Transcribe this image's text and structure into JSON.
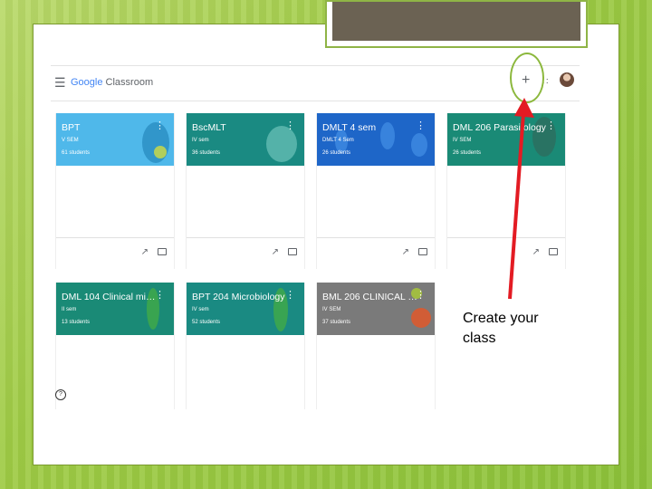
{
  "header": {
    "logo_prefix": "Google",
    "logo_suffix": " Classroom",
    "add_label": "+",
    "apps_label": "∷"
  },
  "classes": [
    {
      "title": "BPT",
      "subtitle": "V SEM",
      "students": "61 students",
      "color": "#4fb8ea"
    },
    {
      "title": "BscMLT",
      "subtitle": "IV sem",
      "students": "36 students",
      "color": "#1a8a82"
    },
    {
      "title": "DMLT 4 sem",
      "subtitle": "DMLT 4 Sem",
      "students": "26 students",
      "color": "#1e66c8"
    },
    {
      "title": "DML 206 Parasitology",
      "subtitle": "IV SEM",
      "students": "26 students",
      "color": "#1a8a76"
    },
    {
      "title": "DML 104 Clinical micr...",
      "subtitle": "II sem",
      "students": "13 students",
      "color": "#1a8a76"
    },
    {
      "title": "BPT 204 Microbiology",
      "subtitle": "IV sem",
      "students": "52 students",
      "color": "#1a8a82"
    },
    {
      "title": "BML 206 CLINICAL P...",
      "subtitle": "IV SEM",
      "students": "37 students",
      "color": "#7a7a7a"
    }
  ],
  "help_label": "?",
  "callout": {
    "line1": "Create your",
    "line2": "class"
  },
  "accent": {
    "arrow": "#e31b23",
    "highlight": "#8cb83d"
  },
  "icons": {
    "trend": "trending-icon",
    "folder": "folder-icon",
    "kebab": "more-vert-icon"
  }
}
